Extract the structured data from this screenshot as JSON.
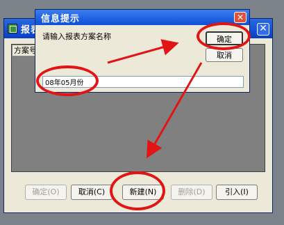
{
  "main_window": {
    "title": "报表",
    "column_header": "方案号",
    "close_glyph": "✕",
    "buttons": {
      "ok": "确定(O)",
      "cancel": "取消(C)",
      "new": "新建(N)",
      "delete": "删除(D)",
      "import": "引入(I)"
    }
  },
  "dialog": {
    "title": "信息提示",
    "close_glyph": "✕",
    "prompt": "请输入报表方案名称",
    "ok_label": "确定",
    "cancel_label": "取消",
    "input_value": "08年05月份"
  },
  "colors": {
    "annotation": "#e11515",
    "titlebar": "#0a3fc4",
    "window_face": "#ece9d8"
  }
}
